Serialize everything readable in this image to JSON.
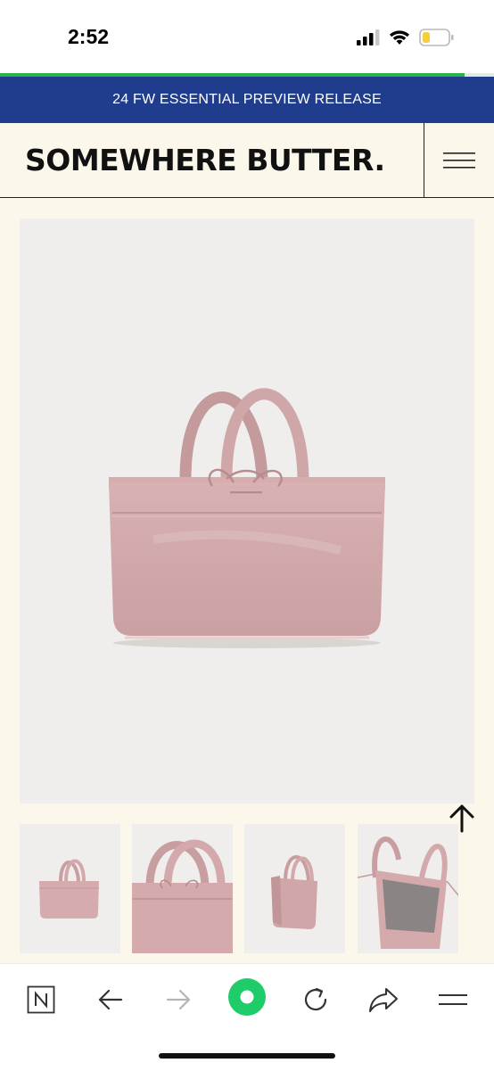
{
  "status_bar": {
    "time": "2:52"
  },
  "page_load_progress": 0.94,
  "announcement": {
    "text": "24 FW ESSENTIAL PREVIEW RELEASE"
  },
  "header": {
    "logo": "SOMEWHERE BUTTER."
  },
  "icons": {
    "signal": "cellular-signal-icon",
    "wifi": "wifi-icon",
    "battery": "battery-low-icon",
    "menu": "hamburger-menu-icon",
    "scroll_top": "arrow-up-icon",
    "nav_home": "naver-n-icon",
    "nav_back": "arrow-left-icon",
    "nav_forward": "arrow-right-icon",
    "nav_green": "green-record-icon",
    "nav_reload": "reload-icon",
    "nav_share": "share-icon",
    "nav_menu": "menu-lines-icon"
  },
  "colors": {
    "announce_bg": "#1f3d8c",
    "page_bg": "#fbf7ea",
    "bag_pink": "#d4aaac",
    "accent_green": "#1ecd6a",
    "progress_green": "#2bb24c"
  },
  "thumbnails": [
    "front",
    "close-up",
    "side",
    "interior"
  ]
}
